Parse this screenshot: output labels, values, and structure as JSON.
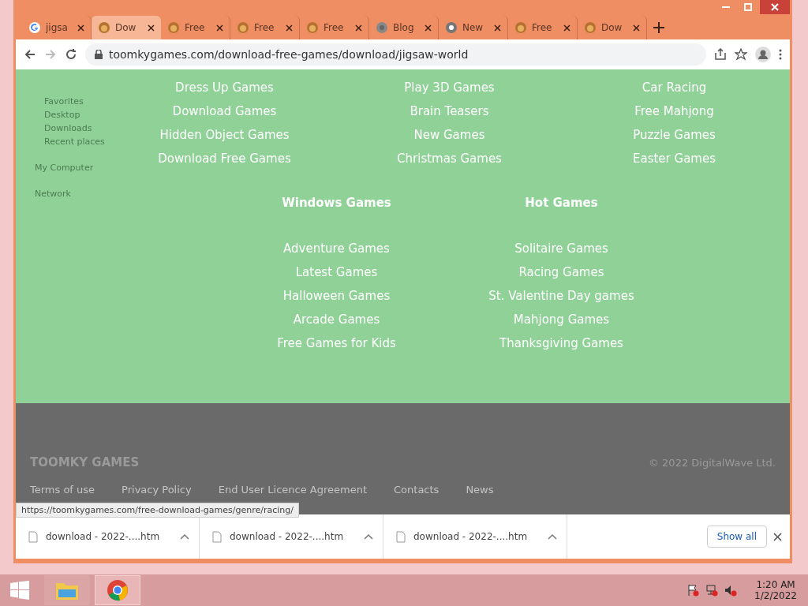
{
  "tabs": [
    {
      "label": "jigsa",
      "kind": "google",
      "selected": false
    },
    {
      "label": "Dow",
      "kind": "game",
      "selected": true
    },
    {
      "label": "Free",
      "kind": "game",
      "selected": false
    },
    {
      "label": "Free",
      "kind": "game",
      "selected": false
    },
    {
      "label": "Free",
      "kind": "game",
      "selected": false
    },
    {
      "label": "Blog",
      "kind": "blog",
      "selected": false
    },
    {
      "label": "New",
      "kind": "chrome",
      "selected": false
    },
    {
      "label": "Free",
      "kind": "game",
      "selected": false
    },
    {
      "label": "Dow",
      "kind": "game",
      "selected": false
    }
  ],
  "address_bar": {
    "url": "toomkygames.com/download-free-games/download/jigsaw-world"
  },
  "explorer_sidebar": [
    "Favorites",
    "Desktop",
    "Downloads",
    "Recent places",
    "My Computer",
    "Network"
  ],
  "menu": {
    "top_columns": [
      [
        "Dress Up Games",
        "Download Games",
        "Hidden Object Games",
        "Download Free Games"
      ],
      [
        "Play 3D Games",
        "Brain Teasers",
        "New Games",
        "Christmas Games"
      ],
      [
        "Car Racing",
        "Free Mahjong",
        "Puzzle Games",
        "Easter Games"
      ]
    ],
    "sections": [
      {
        "heading": "Windows Games",
        "items": [
          "Adventure Games",
          "Latest Games",
          "Halloween Games",
          "Arcade Games",
          "Free Games for Kids"
        ]
      },
      {
        "heading": "Hot Games",
        "items": [
          "Solitaire Games",
          "Racing Games",
          "St. Valentine Day games",
          "Mahjong Games",
          "Thanksgiving Games"
        ]
      }
    ]
  },
  "footer": {
    "brand": "TOOMKY GAMES",
    "copyright": "© 2022 DigitalWave Ltd.",
    "links": [
      "Terms of use",
      "Privacy Policy",
      "End User Licence Agreement",
      "Contacts",
      "News"
    ]
  },
  "status_url": "https://toomkygames.com/free-download-games/genre/racing/",
  "downloads": {
    "items": [
      "download - 2022-....htm",
      "download - 2022-....htm",
      "download - 2022-....htm"
    ],
    "show_all": "Show all"
  },
  "taskbar": {
    "apps": [
      {
        "kind": "explorer",
        "selected": false
      },
      {
        "kind": "chrome",
        "selected": true
      }
    ],
    "time": "1:20 AM",
    "date": "1/2/2022"
  }
}
